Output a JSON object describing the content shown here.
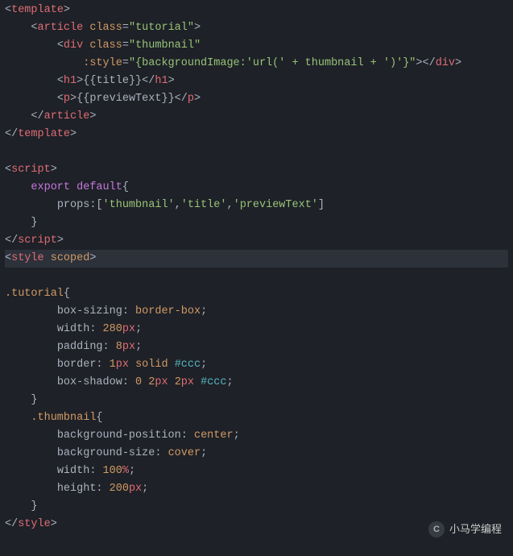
{
  "lines": [
    {
      "cls": "",
      "html": "<span class='c-punct'>&lt;</span><span class='c-tag'>template</span><span class='c-punct'>&gt;</span>"
    },
    {
      "cls": "",
      "html": "    <span class='c-punct'>&lt;</span><span class='c-tag'>article</span> <span class='c-attr'>class</span><span class='c-punct'>=</span><span class='c-string'>\"tutorial\"</span><span class='c-punct'>&gt;</span>"
    },
    {
      "cls": "",
      "html": "        <span class='c-punct'>&lt;</span><span class='c-tag'>div</span> <span class='c-attr'>class</span><span class='c-punct'>=</span><span class='c-string'>\"thumbnail\"</span>"
    },
    {
      "cls": "",
      "html": "            <span class='c-attr'>:style</span><span class='c-punct'>=</span><span class='c-string'>\"{backgroundImage:'url(' + thumbnail + ')'}\"</span><span class='c-punct'>&gt;&lt;/</span><span class='c-tag'>div</span><span class='c-punct'>&gt;</span>"
    },
    {
      "cls": "",
      "html": "        <span class='c-punct'>&lt;</span><span class='c-tag'>h1</span><span class='c-punct'>&gt;{{</span><span class='c-prop'>title</span><span class='c-punct'>}}&lt;/</span><span class='c-tag'>h1</span><span class='c-punct'>&gt;</span>"
    },
    {
      "cls": "",
      "html": "        <span class='c-punct'>&lt;</span><span class='c-tag'>p</span><span class='c-punct'>&gt;{{</span><span class='c-prop'>previewText</span><span class='c-punct'>}}&lt;/</span><span class='c-tag'>p</span><span class='c-punct'>&gt;</span>"
    },
    {
      "cls": "",
      "html": "    <span class='c-punct'>&lt;/</span><span class='c-tag'>article</span><span class='c-punct'>&gt;</span>"
    },
    {
      "cls": "",
      "html": "<span class='c-punct'>&lt;/</span><span class='c-tag'>template</span><span class='c-punct'>&gt;</span>"
    },
    {
      "cls": "",
      "html": " "
    },
    {
      "cls": "",
      "html": "<span class='c-punct'>&lt;</span><span class='c-tag'>script</span><span class='c-punct'>&gt;</span>"
    },
    {
      "cls": "",
      "html": "    <span class='c-purple'>export</span> <span class='c-purple'>default</span><span class='c-bracket'>{</span>"
    },
    {
      "cls": "",
      "html": "        <span class='c-prop'>props</span><span class='c-punct'>:[</span><span class='c-string'>'thumbnail'</span><span class='c-punct'>,</span><span class='c-string'>'title'</span><span class='c-punct'>,</span><span class='c-string'>'previewText'</span><span class='c-punct'>]</span>"
    },
    {
      "cls": "",
      "html": "    <span class='c-bracket'>}</span>"
    },
    {
      "cls": "",
      "html": "<span class='c-punct'>&lt;/</span><span class='c-tag'>script</span><span class='c-punct'>&gt;</span>"
    },
    {
      "cls": "current-line",
      "html": "<span class='c-punct'>&lt;</span><span class='c-tag'>style</span> <span class='c-attr'>scoped</span><span class='c-punct'>&gt;</span>"
    },
    {
      "cls": "",
      "html": " "
    },
    {
      "cls": "",
      "html": "<span class='c-sel'>.tutorial</span><span class='c-bracket'>{</span>"
    },
    {
      "cls": "",
      "html": "        <span class='c-csskey'>box-sizing</span><span class='c-punct'>:</span> <span class='c-cssval'>border-box</span><span class='c-punct'>;</span>"
    },
    {
      "cls": "",
      "html": "        <span class='c-csskey'>width</span><span class='c-punct'>:</span> <span class='c-num'>280</span><span class='c-unit'>px</span><span class='c-punct'>;</span>"
    },
    {
      "cls": "",
      "html": "        <span class='c-csskey'>padding</span><span class='c-punct'>:</span> <span class='c-num'>8</span><span class='c-unit'>px</span><span class='c-punct'>;</span>"
    },
    {
      "cls": "",
      "html": "        <span class='c-csskey'>border</span><span class='c-punct'>:</span> <span class='c-num'>1</span><span class='c-unit'>px</span> <span class='c-cssval'>solid</span> <span class='c-cyan'>#ccc</span><span class='c-punct'>;</span>"
    },
    {
      "cls": "",
      "html": "        <span class='c-csskey'>box-shadow</span><span class='c-punct'>:</span> <span class='c-num'>0</span> <span class='c-num'>2</span><span class='c-unit'>px</span> <span class='c-num'>2</span><span class='c-unit'>px</span> <span class='c-cyan'>#ccc</span><span class='c-punct'>;</span>"
    },
    {
      "cls": "",
      "html": "    <span class='c-bracket'>}</span>"
    },
    {
      "cls": "",
      "html": "    <span class='c-sel'>.thumbnail</span><span class='c-bracket'>{</span>"
    },
    {
      "cls": "",
      "html": "        <span class='c-csskey'>background-position</span><span class='c-punct'>:</span> <span class='c-cssval'>center</span><span class='c-punct'>;</span>"
    },
    {
      "cls": "",
      "html": "        <span class='c-csskey'>background-size</span><span class='c-punct'>:</span> <span class='c-cssval'>cover</span><span class='c-punct'>;</span>"
    },
    {
      "cls": "",
      "html": "        <span class='c-csskey'>width</span><span class='c-punct'>:</span> <span class='c-num'>100</span><span class='c-unit'>%</span><span class='c-punct'>;</span>"
    },
    {
      "cls": "",
      "html": "        <span class='c-csskey'>height</span><span class='c-punct'>:</span> <span class='c-num'>200</span><span class='c-unit'>px</span><span class='c-punct'>;</span>"
    },
    {
      "cls": "",
      "html": "    <span class='c-bracket'>}</span>"
    },
    {
      "cls": "",
      "html": "<span class='c-punct'>&lt;/</span><span class='c-tag'>style</span><span class='c-punct'>&gt;</span>"
    }
  ],
  "watermark": {
    "icon_text": "C",
    "label": "小马学编程"
  }
}
